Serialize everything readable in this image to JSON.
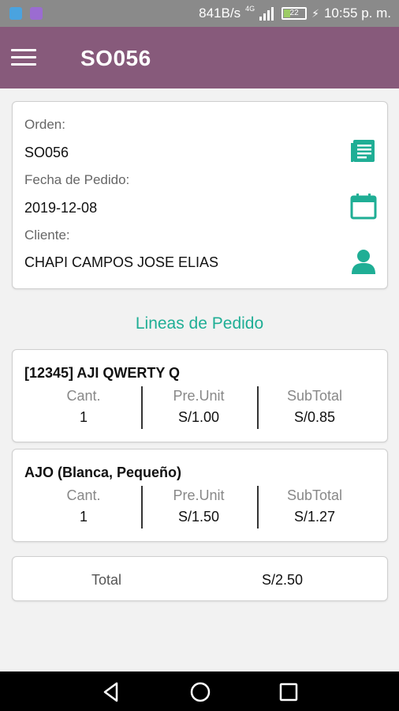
{
  "status_bar": {
    "network_speed": "841B/s",
    "network_type": "4G",
    "battery_level": "22",
    "time": "10:55 p. m."
  },
  "app_bar": {
    "title": "SO056",
    "menu_icon": "hamburger-menu-icon"
  },
  "order": {
    "order_label": "Orden:",
    "order_value": "SO056",
    "date_label": "Fecha de Pedido:",
    "date_value": "2019-12-08",
    "client_label": "Cliente:",
    "client_value": "CHAPI CAMPOS JOSE ELIAS",
    "icons": [
      "document-list-icon",
      "calendar-icon",
      "person-icon"
    ]
  },
  "lines_section_title": "Lineas de Pedido",
  "lines": [
    {
      "name": "[12345] AJI QWERTY Q",
      "qty_label": "Cant.",
      "qty": "1",
      "unit_label": "Pre.Unit",
      "unit_price": "S/1.00",
      "subtotal_label": "SubTotal",
      "subtotal": "S/0.85"
    },
    {
      "name": "AJO (Blanca, Pequeño)",
      "qty_label": "Cant.",
      "qty": "1",
      "unit_label": "Pre.Unit",
      "unit_price": "S/1.50",
      "subtotal_label": "SubTotal",
      "subtotal": "S/1.27"
    }
  ],
  "total": {
    "label": "Total",
    "value": "S/2.50"
  },
  "nav_bar": {
    "buttons": [
      "back-icon",
      "home-icon",
      "recents-icon"
    ]
  },
  "colors": {
    "app_bar": "#875a7b",
    "accent": "#1fae95",
    "status_bar": "#8a8a8a"
  }
}
